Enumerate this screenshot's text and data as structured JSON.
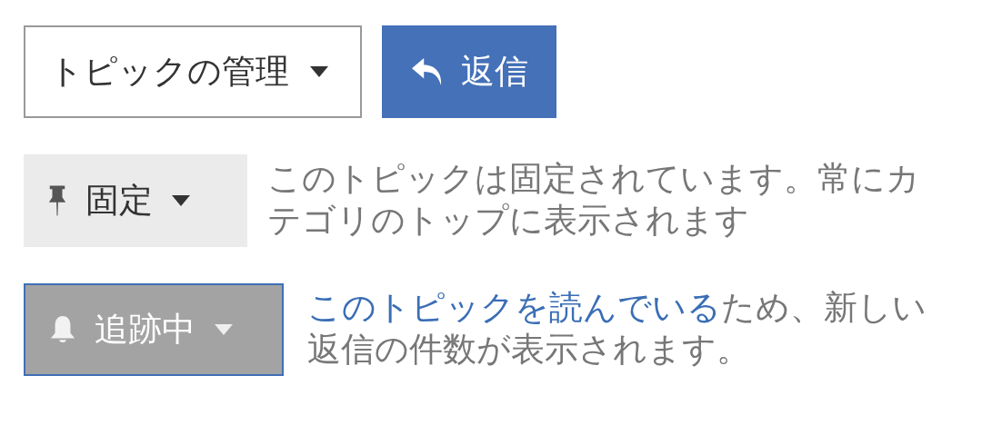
{
  "actions": [
    {
      "kind": "dropdown",
      "label": "トピックの管理"
    },
    {
      "kind": "primary",
      "label": "返信"
    }
  ],
  "pin": {
    "label": "固定",
    "description": "このトピックは固定されています。常にカテゴリのトップに表示されます"
  },
  "notification": {
    "label": "追跡中",
    "link": "このトピックを読んでいる",
    "description": "ため、新しい返信の件数が表示されます。"
  }
}
